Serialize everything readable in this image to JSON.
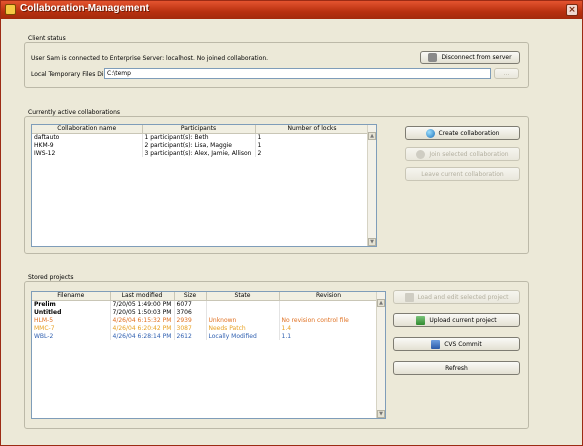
{
  "window": {
    "title": "Collaboration-Management",
    "close_label": "×"
  },
  "client_status": {
    "group_title": "Client status",
    "status_text": "User Sam is connected to Enterprise Server: localhost. No joined collaboration.",
    "disconnect_label": "Disconnect from server",
    "temp_dir_label": "Local Temporary Files Directory",
    "temp_dir_value": "C:\\temp",
    "browse_label": "..."
  },
  "collaborations": {
    "group_title": "Currently active collaborations",
    "columns": [
      "Collaboration name",
      "Participants",
      "Number of locks"
    ],
    "rows": [
      [
        "daftauto",
        "1 participant(s): Beth",
        "1"
      ],
      [
        "HKM-9",
        "2 participant(s): Lisa, Maggie",
        "1"
      ],
      [
        "IWS-12",
        "3 participant(s): Alex, Jamie, Allison",
        "2"
      ]
    ],
    "create_label": "Create collaboration",
    "join_label": "Join selected collaboration",
    "leave_label": "Leave current collaboration"
  },
  "stored_projects": {
    "group_title": "Stored projects",
    "columns": [
      "Filename",
      "Last modified",
      "Size",
      "State",
      "Revision"
    ],
    "rows": [
      {
        "cells": [
          "Prelim",
          "7/20/05 1:49:00 PM",
          "6077",
          "",
          ""
        ],
        "color": "#000000",
        "bold_first": true
      },
      {
        "cells": [
          "Untitled",
          "7/20/05 1:50:03 PM",
          "3706",
          "",
          ""
        ],
        "color": "#000000",
        "bold_first": true
      },
      {
        "cells": [
          "HLM-5",
          "4/26/04 6:15:32 PM",
          "2939",
          "Unknown",
          "No revision control file"
        ],
        "color": "#e07020",
        "bold_first": false
      },
      {
        "cells": [
          "MMC-7",
          "4/26/04 6:20:42 PM",
          "3087",
          "Needs Patch",
          "1.4"
        ],
        "color": "#e8a020",
        "bold_first": false
      },
      {
        "cells": [
          "WBL-2",
          "4/26/04 6:28:14 PM",
          "2612",
          "Locally Modified",
          "1.1"
        ],
        "color": "#3060b0",
        "bold_first": false
      }
    ],
    "load_label": "Load and edit selected project",
    "upload_label": "Upload current project",
    "cvs_label": "CVS Commit",
    "refresh_label": "Refresh"
  },
  "colors": {
    "titlebar": "#b8300f",
    "unknown_state": "#e07020",
    "needs_patch": "#e8a020",
    "locally_modified": "#3060b0"
  }
}
